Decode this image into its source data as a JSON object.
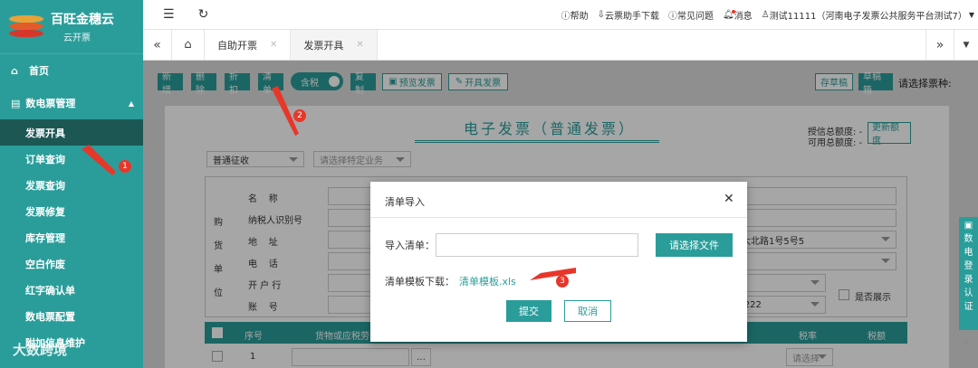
{
  "brand": {
    "name": "百旺金穗云",
    "sub": "云开票"
  },
  "sidebar": {
    "home": "首页",
    "group": "数电票管理",
    "items": [
      "发票开具",
      "订单查询",
      "发票查询",
      "发票修复",
      "库存管理",
      "空白作废",
      "红字确认单",
      "数电票配置",
      "附加信息维护"
    ]
  },
  "topbar": {
    "help": "帮助",
    "download": "云票助手下载",
    "faq": "常见问题",
    "msg": "消息",
    "user": "测试11111（河南电子发票公共服务平台测试7）"
  },
  "tabs": [
    "自助开票",
    "发票开具"
  ],
  "toolbar": {
    "add": "新增",
    "delete": "删除",
    "discount": "折扣",
    "list": "清单",
    "tax_toggle": "含税",
    "copy": "复制",
    "preview": "预览发票",
    "issue": "开具发票",
    "save_draft": "存草稿",
    "draft_box": "草稿箱",
    "select_type": "请选择票种:"
  },
  "invoice": {
    "title": "电子发票（普通发票）",
    "credit_total": "授信总额度: -",
    "avail_total": "可用总额度: -",
    "update": "更新额度",
    "levy": "普通征收",
    "biz_placeholder": "请选择特定业务",
    "buyer": [
      "购",
      "货",
      "单",
      "位"
    ],
    "fields": [
      "名    称",
      "纳税人识别号",
      "地    址",
      "电    话",
      "开 户 行",
      "账    号"
    ],
    "address_val": "桥大北路1号5号5",
    "acct_val": "22222",
    "show_label": "是否展示",
    "table_headers": [
      "序号",
      "货物或应税劳务",
      "税率",
      "税额"
    ],
    "row1": "1",
    "tax_rate_ph": "请选择"
  },
  "modal": {
    "title": "清单导入",
    "import_label": "导入清单：",
    "choose_file": "请选择文件",
    "template_label": "清单模板下载：",
    "template_link": "清单模板.xls",
    "submit": "提交",
    "cancel": "取消"
  },
  "annotations": [
    "1",
    "2",
    "3"
  ],
  "right_widget": "数电登录认证",
  "watermark": "大数跨境",
  "colors": {
    "primary": "#2a9d9a",
    "sidebar_active": "#1c5754",
    "badge": "#e7372a"
  }
}
